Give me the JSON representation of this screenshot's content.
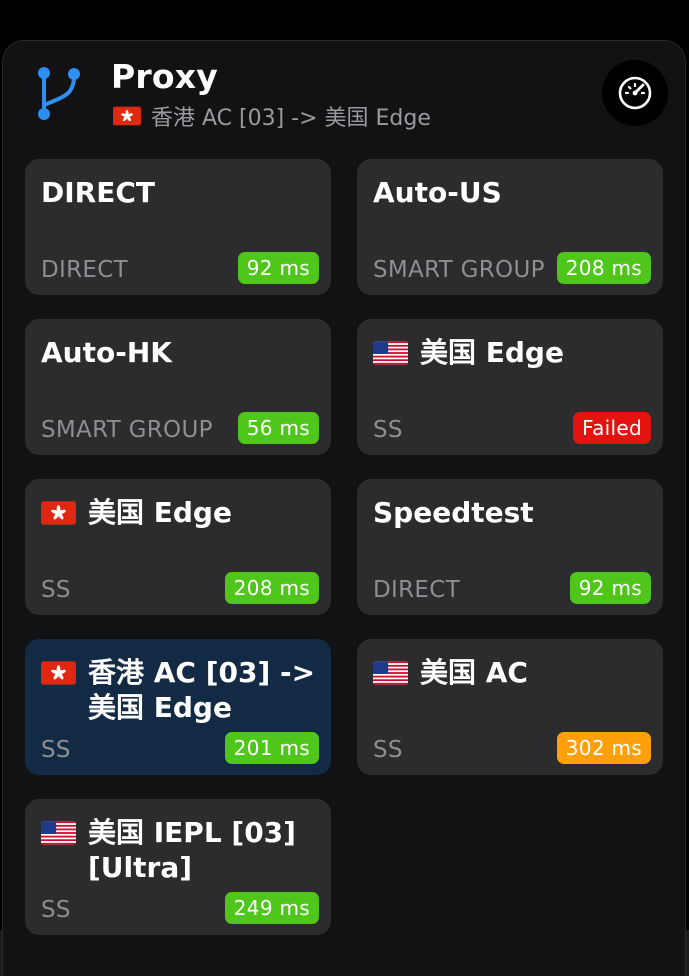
{
  "header": {
    "title": "Proxy",
    "current_selection": "香港 AC [03] -> 美国 Edge",
    "current_flag": "hk"
  },
  "colors": {
    "green": "#4fc71a",
    "red": "#e3140f",
    "orange": "#ff9f0a",
    "selected_bg": "#132a44",
    "icon_blue": "#2f8ff0"
  },
  "proxies": [
    {
      "name": "DIRECT",
      "flag": "",
      "type": "DIRECT",
      "latency": "92 ms",
      "status": "green",
      "selected": false
    },
    {
      "name": "Auto-US",
      "flag": "",
      "type": "SMART GROUP",
      "latency": "208 ms",
      "status": "green",
      "selected": false
    },
    {
      "name": "Auto-HK",
      "flag": "",
      "type": "SMART GROUP",
      "latency": "56 ms",
      "status": "green",
      "selected": false
    },
    {
      "name": "美国 Edge",
      "flag": "us",
      "type": "SS",
      "latency": "Failed",
      "status": "red",
      "selected": false
    },
    {
      "name": "美国 Edge",
      "flag": "hk",
      "type": "SS",
      "latency": "208 ms",
      "status": "green",
      "selected": false
    },
    {
      "name": "Speedtest",
      "flag": "",
      "type": "DIRECT",
      "latency": "92 ms",
      "status": "green",
      "selected": false
    },
    {
      "name": "香港 AC [03] -> 美国 Edge",
      "flag": "hk",
      "type": "SS",
      "latency": "201 ms",
      "status": "green",
      "selected": true
    },
    {
      "name": "美国 AC",
      "flag": "us",
      "type": "SS",
      "latency": "302 ms",
      "status": "orange",
      "selected": false
    },
    {
      "name": "美国 IEPL [03] [Ultra]",
      "flag": "us",
      "type": "SS",
      "latency": "249 ms",
      "status": "green",
      "selected": false
    }
  ],
  "icons": {
    "group_icon": "branch-icon",
    "speed_test": "speedometer-icon"
  }
}
